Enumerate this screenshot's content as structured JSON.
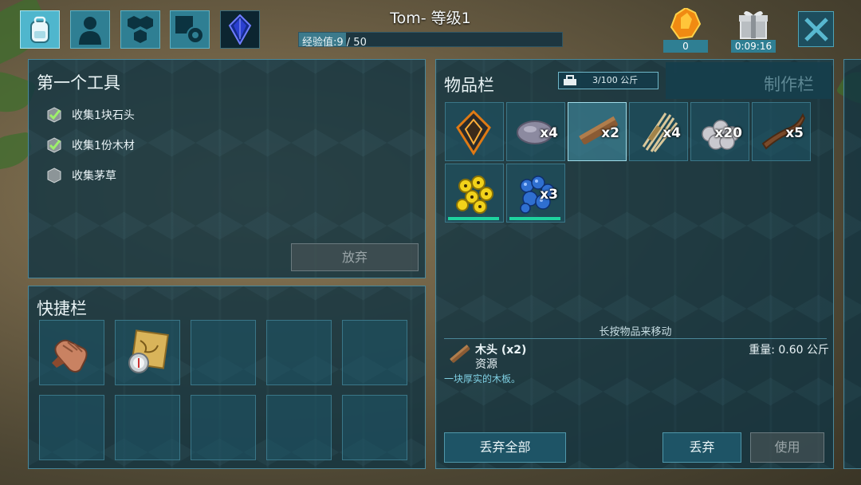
{
  "header": {
    "player_title": "Tom- 等级1",
    "xp_label": "经验值:9 / 50",
    "xp_progress": 0.18
  },
  "top_icons": [
    "backpack-icon",
    "character-icon",
    "engrams-icon",
    "settings-icon",
    "tribe-crystal-icon"
  ],
  "resources": {
    "amber_count": "0",
    "gift_timer": "0:09:16"
  },
  "tasks_panel": {
    "title": "第一个工具",
    "tasks": [
      {
        "label": "收集1块石头",
        "done": true
      },
      {
        "label": "收集1份木材",
        "done": true
      },
      {
        "label": "收集茅草",
        "done": false
      }
    ],
    "abandon_label": "放弃"
  },
  "hotbar": {
    "title": "快捷栏",
    "slots": [
      "hand-icon",
      "map-compass-icon",
      "",
      "",
      "",
      "",
      "",
      "",
      "",
      ""
    ]
  },
  "inventory": {
    "title": "物品栏",
    "weight": "3/100 公斤",
    "crafting_tab": "制作栏",
    "items": [
      {
        "icon": "specimen-implant-icon",
        "qty": ""
      },
      {
        "icon": "stone-icon",
        "qty": "x4"
      },
      {
        "icon": "wood-icon",
        "qty": "x2"
      },
      {
        "icon": "thatch-icon",
        "qty": "x4"
      },
      {
        "icon": "stone-balls-icon",
        "qty": "x20"
      },
      {
        "icon": "wood-branch-icon",
        "qty": "x5"
      },
      {
        "icon": "yellow-berries-icon",
        "qty": ""
      },
      {
        "icon": "blue-berries-icon",
        "qty": "x3"
      }
    ],
    "hint": "长按物品来移动",
    "detail": {
      "name": "木头 (x2)",
      "type": "资源",
      "weight": "重量: 0.60 公斤",
      "description": "一块厚实的木板。"
    },
    "buttons": {
      "drop_all": "丢弃全部",
      "drop": "丢弃",
      "use": "使用"
    }
  },
  "colors": {
    "accent": "#2f7f93",
    "durability": "#1ed39f",
    "panel": "#123442"
  }
}
